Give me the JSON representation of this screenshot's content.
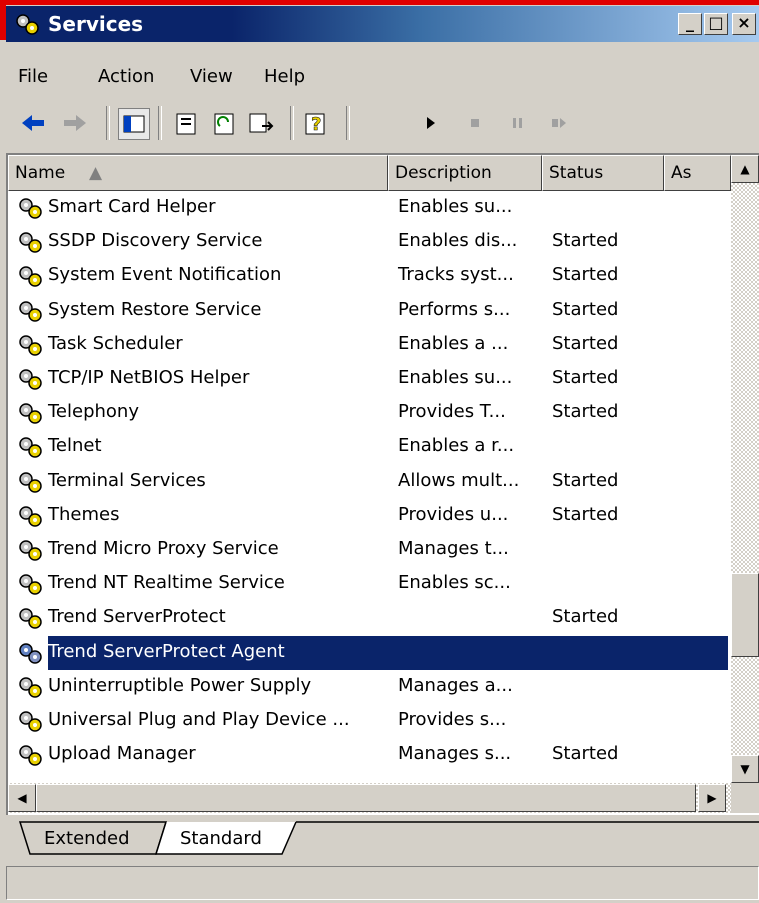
{
  "window": {
    "title": "Services",
    "minimize": "_",
    "maximize": "□",
    "close": "×"
  },
  "menu": {
    "items": [
      "File",
      "Action",
      "View",
      "Help"
    ]
  },
  "toolbar": {
    "icons": [
      "back-icon",
      "forward-icon",
      "show-hide-console-tree-icon",
      "properties-icon",
      "refresh-icon",
      "export-list-icon",
      "help-icon",
      "start-service-icon",
      "stop-service-icon",
      "pause-service-icon",
      "restart-service-icon"
    ]
  },
  "columns": [
    "Name",
    "Description",
    "Status",
    "As"
  ],
  "services": [
    {
      "name": "Smart Card Helper",
      "description": "Enables su...",
      "status": ""
    },
    {
      "name": "SSDP Discovery Service",
      "description": "Enables dis...",
      "status": "Started"
    },
    {
      "name": "System Event Notification",
      "description": "Tracks syst...",
      "status": "Started"
    },
    {
      "name": "System Restore Service",
      "description": "Performs s...",
      "status": "Started"
    },
    {
      "name": "Task Scheduler",
      "description": "Enables a ...",
      "status": "Started"
    },
    {
      "name": "TCP/IP NetBIOS Helper",
      "description": "Enables su...",
      "status": "Started"
    },
    {
      "name": "Telephony",
      "description": "Provides T...",
      "status": "Started"
    },
    {
      "name": "Telnet",
      "description": "Enables a r...",
      "status": ""
    },
    {
      "name": "Terminal Services",
      "description": "Allows mult...",
      "status": "Started"
    },
    {
      "name": "Themes",
      "description": "Provides u...",
      "status": "Started"
    },
    {
      "name": "Trend Micro Proxy Service",
      "description": "Manages t...",
      "status": ""
    },
    {
      "name": "Trend NT Realtime Service",
      "description": "Enables sc...",
      "status": ""
    },
    {
      "name": "Trend ServerProtect",
      "description": "",
      "status": "Started"
    },
    {
      "name": "Trend ServerProtect Agent",
      "description": "",
      "status": "",
      "selected": true
    },
    {
      "name": "Uninterruptible Power Supply",
      "description": "Manages a...",
      "status": ""
    },
    {
      "name": "Universal Plug and Play Device ...",
      "description": "Provides s...",
      "status": ""
    },
    {
      "name": "Upload Manager",
      "description": "Manages s...",
      "status": "Started"
    }
  ],
  "tabs": [
    "Extended",
    "Standard"
  ],
  "active_tab": "Standard",
  "colors": {
    "selection": "#0a246a",
    "face": "#d4d0c8",
    "title_start": "#0a246a",
    "title_end": "#a6caf0"
  }
}
